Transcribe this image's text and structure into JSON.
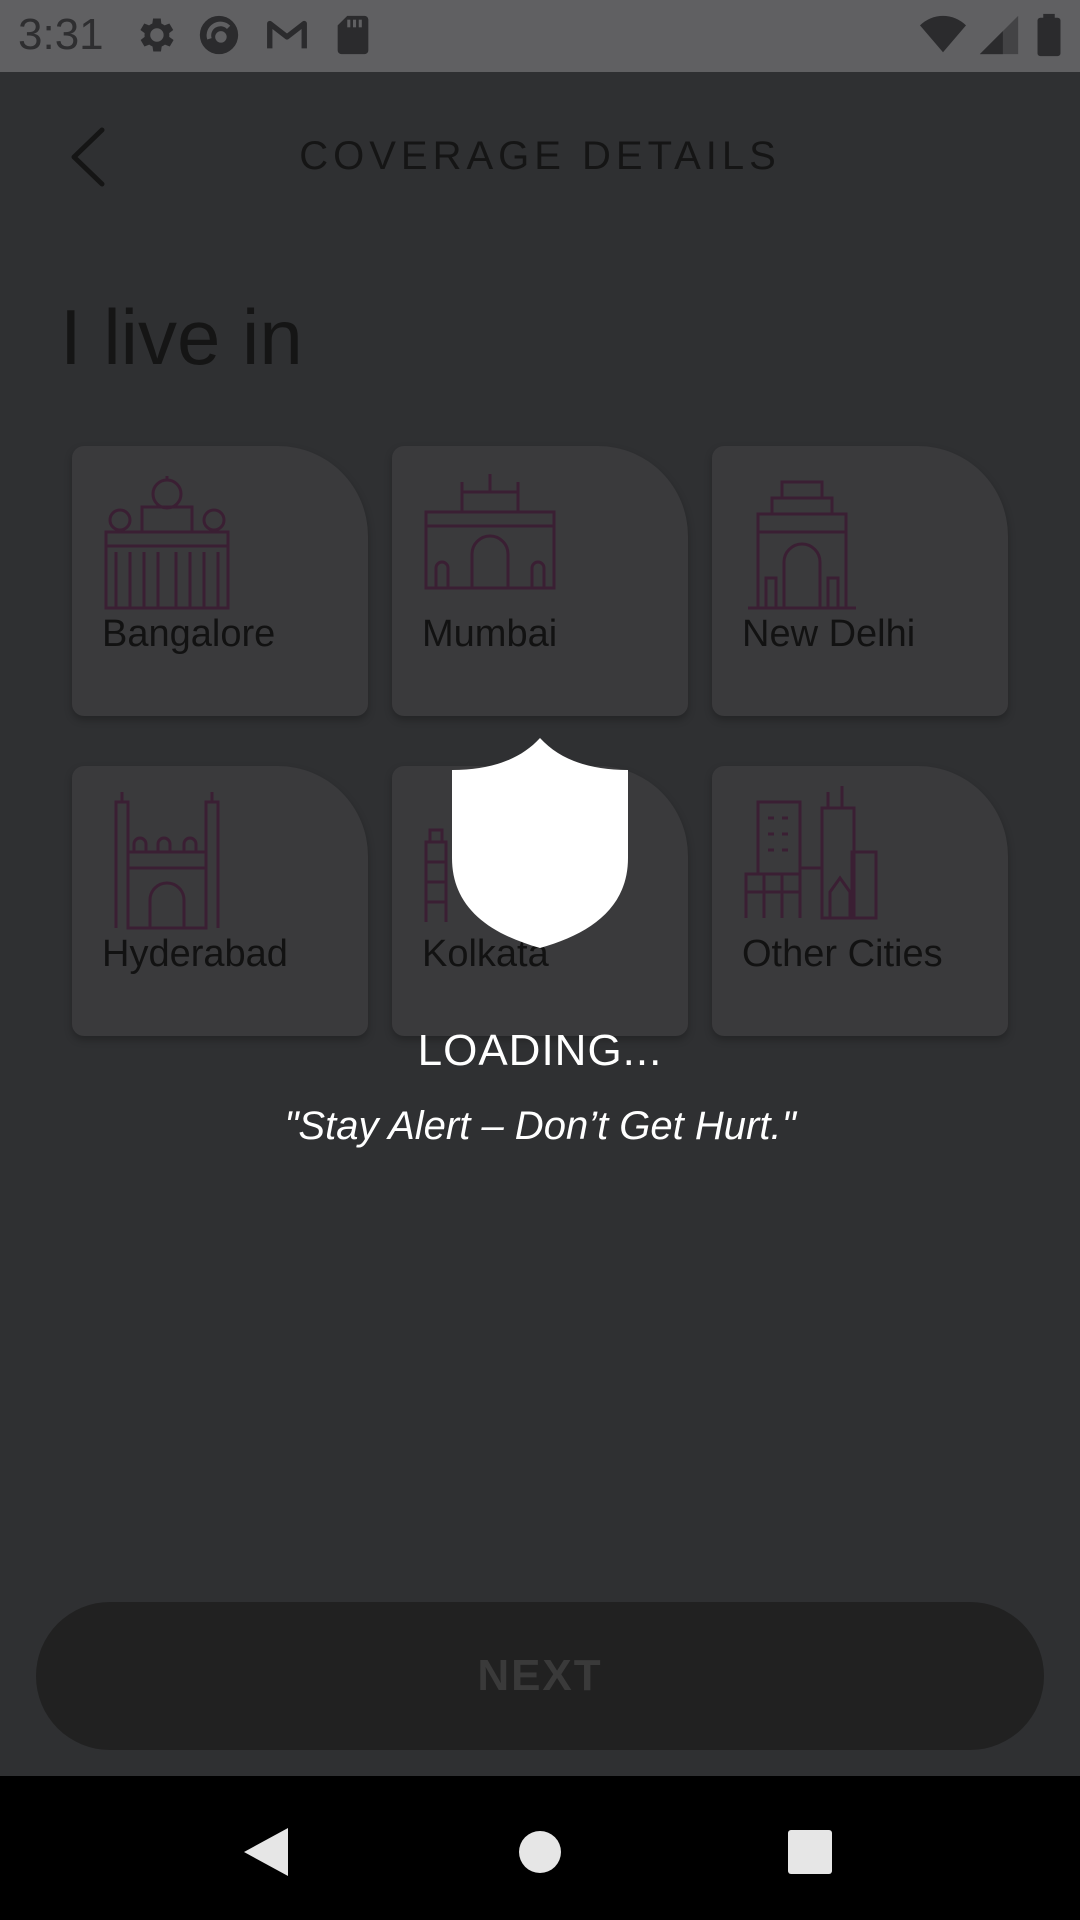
{
  "status_bar": {
    "time": "3:31",
    "icons": [
      "settings-icon",
      "camera-app-icon",
      "gmail-icon",
      "sd-card-icon",
      "wifi-icon",
      "signal-icon",
      "battery-icon"
    ]
  },
  "header": {
    "title": "COVERAGE DETAILS",
    "back_icon": "chevron-left-icon"
  },
  "section": {
    "title": "I live in"
  },
  "cities": [
    {
      "label": "Bangalore",
      "icon": "vidhana-soudha-icon"
    },
    {
      "label": "Mumbai",
      "icon": "gateway-of-india-icon"
    },
    {
      "label": "New Delhi",
      "icon": "india-gate-icon"
    },
    {
      "label": "Hyderabad",
      "icon": "charminar-icon"
    },
    {
      "label": "Kolkata",
      "icon": "howrah-icon"
    },
    {
      "label": "Other Cities",
      "icon": "city-buildings-icon"
    }
  ],
  "next_button": {
    "label": "NEXT"
  },
  "loading": {
    "icon": "shield-icon",
    "text": "LOADING...",
    "quote": "\"Stay Alert – Don’t Get Hurt.\""
  },
  "nav": {
    "back": "back-triangle-icon",
    "home": "home-circle-icon",
    "recents": "recents-square-icon"
  },
  "colors": {
    "overlay_bg": "#2f3032",
    "card_bg": "#3a3a3c",
    "icon_stroke": "#3a1f33",
    "button_bg": "#212121"
  }
}
